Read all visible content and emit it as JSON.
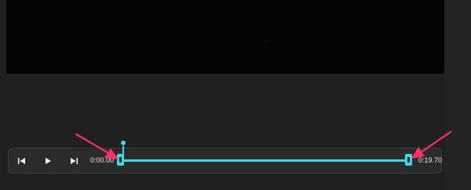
{
  "player": {
    "current_time": "0:00.00",
    "end_time": "0:19.70"
  },
  "controls": {
    "prev_frame_icon": "skip-back-icon",
    "play_icon": "play-icon",
    "next_frame_icon": "skip-forward-icon"
  },
  "colors": {
    "accent": "#3fd9e6",
    "annotation": "#ff2d6a",
    "background": "#202020",
    "video": "#050505"
  }
}
